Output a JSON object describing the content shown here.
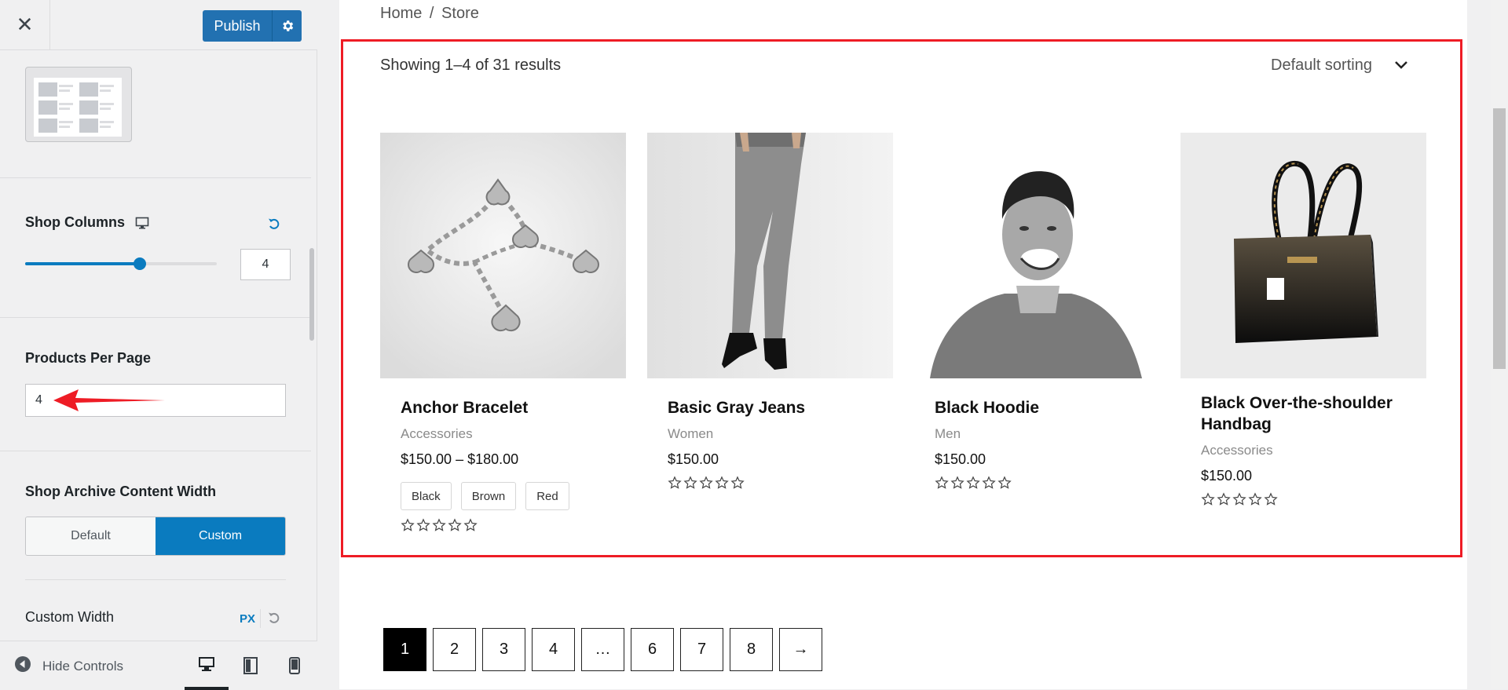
{
  "sidebar": {
    "close_label": "✕",
    "publish_label": "Publish",
    "shop_columns": {
      "label": "Shop Columns",
      "value": "4",
      "slider_fraction": 0.6
    },
    "products_per_page": {
      "label": "Products Per Page",
      "value": "4"
    },
    "content_width": {
      "label": "Shop Archive Content Width",
      "options": [
        "Default",
        "Custom"
      ],
      "selected": "Custom"
    },
    "custom_width": {
      "label": "Custom Width",
      "unit": "PX"
    },
    "footer": {
      "hide_controls": "Hide Controls"
    }
  },
  "preview": {
    "breadcrumb": {
      "home": "Home",
      "separator": "/",
      "current": "Store"
    },
    "result_count": "Showing 1–4 of 31 results",
    "sorting": "Default sorting",
    "products": [
      {
        "title": "Anchor Bracelet",
        "category": "Accessories",
        "price": "$150.00 – $180.00",
        "swatches": [
          "Black",
          "Brown",
          "Red"
        ],
        "rating": 0
      },
      {
        "title": "Basic Gray Jeans",
        "category": "Women",
        "price": "$150.00",
        "rating": 0
      },
      {
        "title": "Black Hoodie",
        "category": "Men",
        "price": "$150.00",
        "rating": 0
      },
      {
        "title": "Black Over-the-shoulder Handbag",
        "category": "Accessories",
        "price": "$150.00",
        "rating": 0
      }
    ],
    "pagination": [
      "1",
      "2",
      "3",
      "4",
      "…",
      "6",
      "7",
      "8",
      "→"
    ],
    "current_page": "1"
  },
  "colors": {
    "accent": "#0a7bbf",
    "publish": "#2271b1",
    "highlight": "#ee1c25"
  }
}
